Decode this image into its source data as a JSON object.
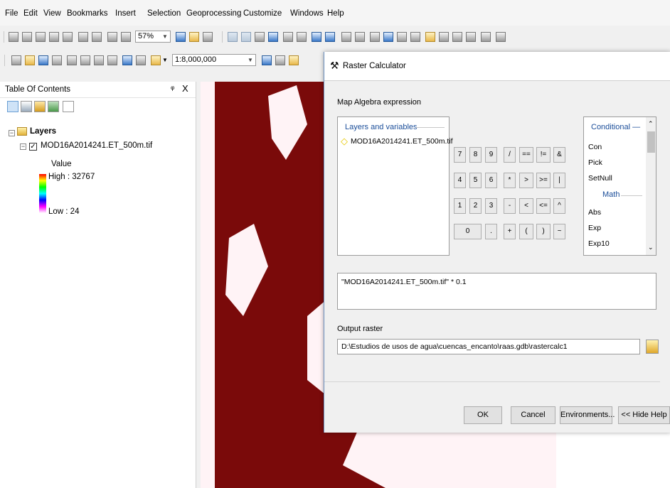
{
  "menu": [
    "File",
    "Edit",
    "View",
    "Bookmarks",
    "Insert",
    "Selection",
    "Geoprocessing",
    "Customize",
    "Windows",
    "Help"
  ],
  "toolbar": {
    "zoom_percent": "57%",
    "scale": "1:8,000,000"
  },
  "toc": {
    "title": "Table Of Contents",
    "pin": "$",
    "close": "X",
    "root_label": "Layers",
    "layer_name": "MOD16A2014241.ET_500m.tif",
    "legend_title": "Value",
    "high_label": "High : 32767",
    "low_label": "Low : 24"
  },
  "dialog": {
    "title": "Raster Calculator",
    "expression_label": "Map Algebra expression",
    "layers_group_label": "Layers and variables",
    "layer_item": "MOD16A2014241.ET_500m.tif",
    "calculator": [
      [
        "7",
        "8",
        "9",
        "/",
        "==",
        "!=",
        "&"
      ],
      [
        "4",
        "5",
        "6",
        "*",
        ">",
        ">=",
        "|"
      ],
      [
        "1",
        "2",
        "3",
        "-",
        "<",
        "<=",
        "^"
      ],
      [
        "0",
        ".",
        "+",
        "(",
        ")",
        "~"
      ]
    ],
    "conditional_label": "Conditional —",
    "conditional_items": [
      "Con",
      "Pick",
      "SetNull"
    ],
    "math_label": "Math",
    "math_items": [
      "Abs",
      "Exp",
      "Exp10"
    ],
    "expression": "\"MOD16A2014241.ET_500m.tif\" * 0.1",
    "output_label": "Output raster",
    "output_path": "D:\\Estudios de usos de agua\\cuencas_encanto\\raas.gdb\\rastercalc1",
    "buttons": {
      "ok": "OK",
      "cancel": "Cancel",
      "environments": "Environments...",
      "hide_help": "<< Hide Help"
    }
  },
  "colors": {
    "raster_dark": "#7a0a0a",
    "raster_light": "#fff3f6",
    "accent": "#6b8fbf"
  }
}
